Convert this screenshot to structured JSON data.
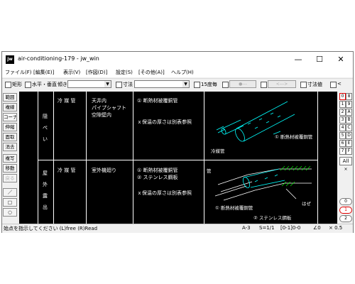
{
  "window": {
    "app_logo": "jw",
    "title": "air-conditioning-179 - jw_win",
    "minimize": "—",
    "maximize": "☐",
    "close": "✕"
  },
  "menu": [
    "ファイル(F)",
    "[編集(E)]",
    "表示(V)",
    "[作図(D)]",
    "設定(S)",
    "[その他(A)]",
    "ヘルプ(H)"
  ],
  "toolbar": {
    "rect_label": "矩形",
    "hv_label": "水平・垂直",
    "tilt_label": "傾き",
    "dim_label": "寸法",
    "deg15_label": "15度毎",
    "btn1": "●---",
    "btn2": "<--->",
    "dimval_label": "寸法値",
    "lt_label": "<"
  },
  "left_tools": [
    "範囲",
    "複線",
    "コーナー",
    "伸縮",
    "面取",
    "消去",
    "複写",
    "移動",
    "戻る",
    "／",
    "□",
    "○"
  ],
  "right_tools": [
    [
      "0",
      "8"
    ],
    [
      "1",
      "9"
    ],
    [
      "2",
      "A"
    ],
    [
      "3",
      "B"
    ],
    [
      "4",
      "C"
    ],
    [
      "5",
      "D"
    ],
    [
      "6",
      "E"
    ],
    [
      "7",
      "F"
    ]
  ],
  "right_all": "All",
  "right_x": "×",
  "right_circles": [
    "0",
    "1",
    "2"
  ],
  "table": {
    "row1": {
      "section": [
        "隠",
        "ぺ",
        "い"
      ],
      "pipe": "冷 媒 管",
      "location": [
        "天井内",
        "パイプシャフト",
        "空隙壁内"
      ],
      "spec": [
        "① 断熱材被覆銅管",
        "",
        "ｘ保温の厚さは別表参照"
      ],
      "diagram_labels": [
        "① 断熱材被覆銅管",
        "冷媒管"
      ]
    },
    "row2": {
      "section": [
        "屋",
        "外",
        "露",
        "出"
      ],
      "pipe": "冷 媒 管",
      "location": [
        "室外機廻り"
      ],
      "spec": [
        "① 断熱材被覆銅管",
        "② ステンレス鋼板",
        "",
        "ｘ保温の厚さは別表参照"
      ],
      "diagram_labels": [
        "管",
        "はぜ",
        "① 断熱材被覆銅管",
        "② ステンレス鋼板"
      ]
    }
  },
  "status": {
    "message": "始点を指示してください (L)free (R)Read",
    "layer": "A-3",
    "scale": "S=1/1",
    "group": "[0-1]0-0",
    "angle": "∠0",
    "zoom": "× 0.5"
  }
}
